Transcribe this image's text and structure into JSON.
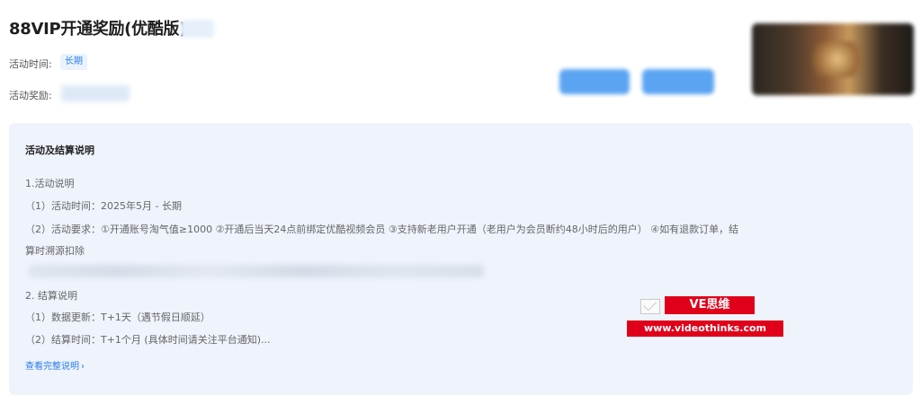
{
  "header": {
    "title": "88VIP开通奖励(优酷版)",
    "time_label": "活动时间:",
    "time_tag": "长期",
    "reward_label": "活动奖励:"
  },
  "panel": {
    "title": "活动及结算说明",
    "lines": [
      "1.活动说明",
      "（1）活动时间：2025年5月 - 长期",
      "（2）活动要求：①开通账号淘气值≥1000 ②开通后当天24点前绑定优酷视频会员 ③支持新老用户开通（老用户为会员断约48小时后的用户） ④如有退款订单，结",
      "算时溯源扣除",
      "2. 结算说明",
      "（1）数据更新：T+1天（遇节假日顺延）",
      "（2）结算时间：T+1个月 (具体时间请关注平台通知)..."
    ],
    "more_link": "查看完整说明",
    "more_icon": "chevron-right-icon"
  },
  "watermark": {
    "name": "VE思维",
    "url": "www.videothinks.com",
    "color": "#e0001a"
  },
  "colors": {
    "accent": "#2b7de9",
    "panel_bg": "#eef3fc"
  }
}
